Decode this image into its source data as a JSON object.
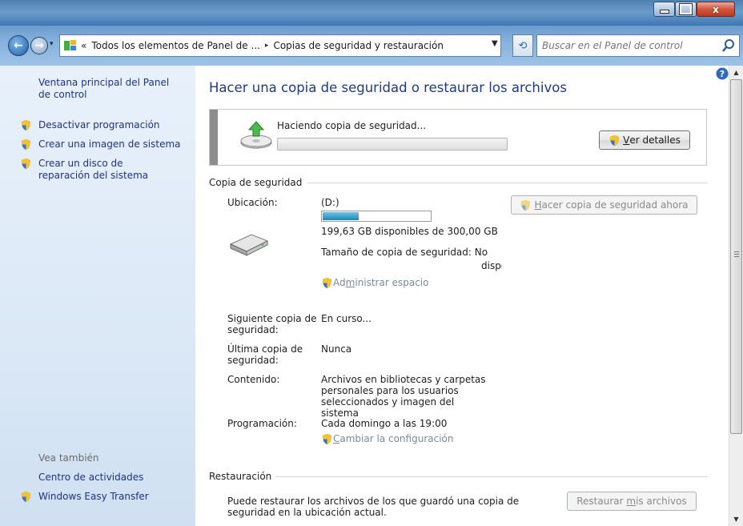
{
  "window": {
    "minimize_icon": "minimize-icon",
    "maximize_icon": "maximize-icon",
    "close_label": "x"
  },
  "nav": {
    "back_icon": "back-arrow-icon",
    "forward_icon": "forward-arrow-icon",
    "breadcrumb": {
      "root_chevron": "«",
      "item1": "Todos los elementos de Panel de ...",
      "separator": "▸",
      "item2": "Copias de seguridad y restauración"
    },
    "dropdown_icon": "chevron-down-icon",
    "refresh_icon": "refresh-icon",
    "search_placeholder": "Buscar en el Panel de control"
  },
  "sidebar": {
    "home_link": "Ventana principal del Panel de control",
    "items": [
      {
        "label": "Desactivar programación",
        "icon": "uac-shield-icon"
      },
      {
        "label": "Crear una imagen de sistema",
        "icon": "uac-shield-icon"
      },
      {
        "label": "Crear un disco de reparación del sistema",
        "icon": "uac-shield-icon"
      }
    ],
    "see_also_title": "Vea también",
    "see_also": [
      {
        "label": "Centro de actividades"
      },
      {
        "label": "Windows Easy Transfer",
        "icon": "uac-shield-icon"
      }
    ]
  },
  "main": {
    "title": "Hacer una copia de seguridad o restaurar los archivos",
    "status": {
      "text": "Haciendo copia de seguridad...",
      "progress": 0,
      "details_button_underlined": "V",
      "details_button_rest": "er detalles"
    },
    "backup": {
      "section_title": "Copia de seguridad",
      "location_label": "Ubicación:",
      "location_value": "(D:)",
      "drive_used_fraction": 0.335,
      "drive_free_text": "199,63 GB disponibles de 300,00 GB",
      "backup_size_text": "Tamaño de copia de seguridad: No",
      "backup_size_text2": "dispo",
      "manage_link_prefix": "Ad",
      "manage_link_underlined": "m",
      "manage_link_rest": "inistrar espacio",
      "backup_now_underlined": "H",
      "backup_now_rest": "acer copia de seguridad ahora",
      "next_label": "Siguiente copia de seguridad:",
      "next_value": "En curso...",
      "last_label": "Última copia de seguridad:",
      "last_value": "Nunca",
      "contents_label": "Contenido:",
      "contents_value": "Archivos en bibliotecas y carpetas personales para los usuarios seleccionados y imagen del sistema",
      "schedule_label": "Programación:",
      "schedule_value": "Cada domingo a las 19:00",
      "change_link_underlined": "C",
      "change_link_rest": "ambiar la configuración"
    },
    "restore": {
      "section_title": "Restauración",
      "text": "Puede restaurar los archivos de los que guardó una copia de seguridad en la ubicación actual.",
      "button_prefix": "Restaurar ",
      "button_underlined": "m",
      "button_rest": "is archivos"
    }
  },
  "colors": {
    "link": "#1e3287",
    "title": "#1e3a8a",
    "drive_fill": "#1c86b9"
  }
}
